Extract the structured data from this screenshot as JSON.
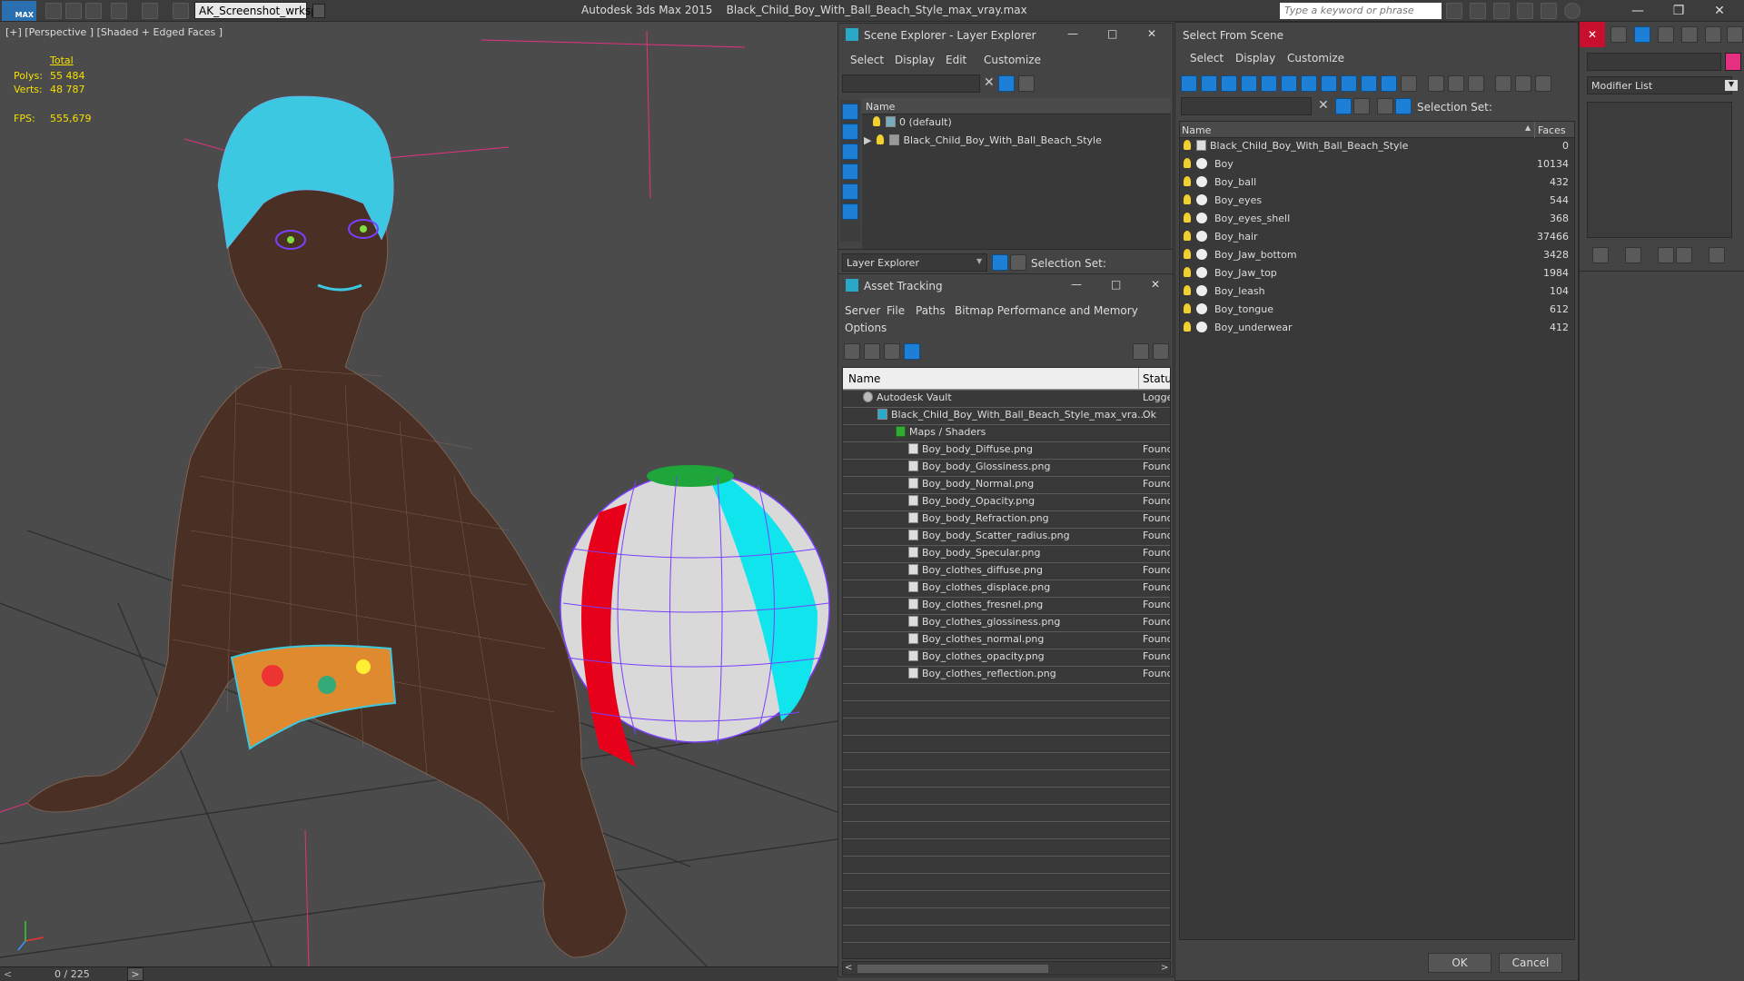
{
  "titlebar": {
    "app_logo": "MAX",
    "workspace": "AK_Screenshot_wrksp",
    "app_name": "Autodesk 3ds Max  2015",
    "file_name": "Black_Child_Boy_With_Ball_Beach_Style_max_vray.max",
    "search_placeholder": "Type a keyword or phrase"
  },
  "viewport": {
    "label": "[+] [Perspective ] [Shaded + Edged Faces ]",
    "stats": {
      "total_label": "Total",
      "polys_label": "Polys:",
      "polys_value": "55 484",
      "verts_label": "Verts:",
      "verts_value": "48 787",
      "fps_label": "FPS:",
      "fps_value": "555,679"
    },
    "timeline": "0 / 225"
  },
  "scene_explorer": {
    "title": "Scene Explorer - Layer Explorer",
    "menu": [
      "Select",
      "Display",
      "Edit",
      "Customize"
    ],
    "col_name": "Name",
    "rows": [
      "0 (default)",
      "Black_Child_Boy_With_Ball_Beach_Style"
    ],
    "footer_dropdown": "Layer Explorer",
    "selection_set": "Selection Set:"
  },
  "asset_tracking": {
    "title": "Asset Tracking",
    "menu": [
      "Server",
      "File",
      "Paths",
      "Bitmap Performance and Memory",
      "Options"
    ],
    "col_name": "Name",
    "col_status": "Status",
    "vault": {
      "name": "Autodesk Vault",
      "status": "Logged"
    },
    "file": {
      "name": "Black_Child_Boy_With_Ball_Beach_Style_max_vra...",
      "status": "Ok"
    },
    "folder": "Maps / Shaders",
    "maps": [
      {
        "name": "Boy_body_Diffuse.png",
        "status": "Found"
      },
      {
        "name": "Boy_body_Glossiness.png",
        "status": "Found"
      },
      {
        "name": "Boy_body_Normal.png",
        "status": "Found"
      },
      {
        "name": "Boy_body_Opacity.png",
        "status": "Found"
      },
      {
        "name": "Boy_body_Refraction.png",
        "status": "Found"
      },
      {
        "name": "Boy_body_Scatter_radius.png",
        "status": "Found"
      },
      {
        "name": "Boy_body_Specular.png",
        "status": "Found"
      },
      {
        "name": "Boy_clothes_diffuse.png",
        "status": "Found"
      },
      {
        "name": "Boy_clothes_displace.png",
        "status": "Found"
      },
      {
        "name": "Boy_clothes_fresnel.png",
        "status": "Found"
      },
      {
        "name": "Boy_clothes_glossiness.png",
        "status": "Found"
      },
      {
        "name": "Boy_clothes_normal.png",
        "status": "Found"
      },
      {
        "name": "Boy_clothes_opacity.png",
        "status": "Found"
      },
      {
        "name": "Boy_clothes_reflection.png",
        "status": "Found"
      }
    ]
  },
  "select_from_scene": {
    "title": "Select From Scene",
    "menu": [
      "Select",
      "Display",
      "Customize"
    ],
    "selection_set": "Selection Set:",
    "col_name": "Name",
    "col_faces": "Faces",
    "rows": [
      {
        "name": "Black_Child_Boy_With_Ball_Beach_Style",
        "faces": "0"
      },
      {
        "name": "Boy",
        "faces": "10134"
      },
      {
        "name": "Boy_ball",
        "faces": "432"
      },
      {
        "name": "Boy_eyes",
        "faces": "544"
      },
      {
        "name": "Boy_eyes_shell",
        "faces": "368"
      },
      {
        "name": "Boy_hair",
        "faces": "37466"
      },
      {
        "name": "Boy_Jaw_bottom",
        "faces": "3428"
      },
      {
        "name": "Boy_Jaw_top",
        "faces": "1984"
      },
      {
        "name": "Boy_leash",
        "faces": "104"
      },
      {
        "name": "Boy_tongue",
        "faces": "612"
      },
      {
        "name": "Boy_underwear",
        "faces": "412"
      }
    ],
    "ok": "OK",
    "cancel": "Cancel"
  },
  "command_panel": {
    "modifier_list": "Modifier List"
  }
}
